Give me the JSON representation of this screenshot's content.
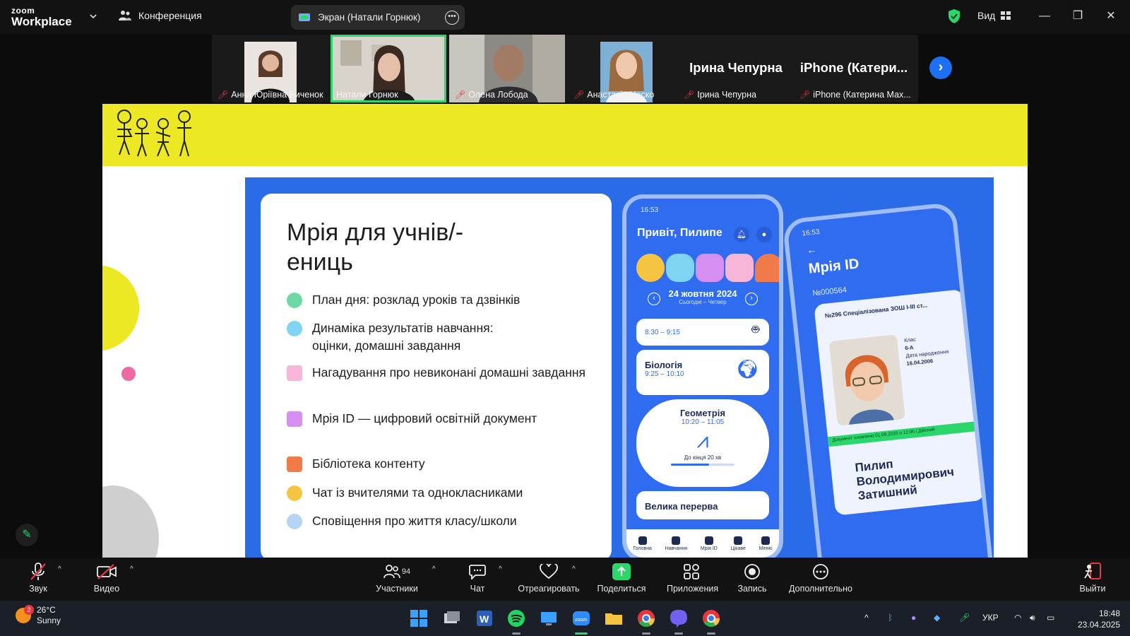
{
  "titlebar": {
    "app_logo_top": "zoom",
    "app_logo_bottom": "Workplace",
    "conference_label": "Конференция",
    "share_pill_label": "Экран (Натали Горнюк)",
    "view_label": "Вид"
  },
  "participants": [
    {
      "name": "Анна Юріївна Биченок",
      "kind": "video",
      "active": false
    },
    {
      "name": "Натали Горнюк",
      "kind": "video",
      "active": true
    },
    {
      "name": "Олена Лобода",
      "kind": "video",
      "active": false
    },
    {
      "name": "Анастасія Носко",
      "kind": "video",
      "active": false
    },
    {
      "name": "Ірина Чепурна",
      "display": "Ірина Чепурна",
      "kind": "name",
      "active": false
    },
    {
      "name": "iPhone (Катерина Мах...",
      "display": "iPhone (Катери...",
      "kind": "name",
      "active": false
    }
  ],
  "slide": {
    "title": "Мрія для учнів/-ениць",
    "features": [
      {
        "text": "План дня: розклад уроків та дзвінків",
        "color": "#6fd9a4",
        "shape": "round"
      },
      {
        "text": "Динаміка результатів навчання: оцінки, домашні завдання",
        "color": "#7fd4f2",
        "shape": "round"
      },
      {
        "text": "Нагадування про невиконані домашні завдання",
        "color": "#f7b6d8",
        "shape": "sq"
      },
      {
        "text": "Мрія ID —  цифровий освітній документ",
        "color": "#d58ff0",
        "shape": "sq"
      },
      {
        "text": "Бібліотека контенту",
        "color": "#f07a4a",
        "shape": "sq"
      },
      {
        "text": "Чат із вчителями та однокласниками",
        "color": "#f5c542",
        "shape": "round"
      },
      {
        "text": "Сповіщення про життя класу/школи",
        "color": "#b8d4f5",
        "shape": "round"
      }
    ],
    "phone1": {
      "time": "16:53",
      "greeting": "Привіт, Пилипе",
      "date": "24 жовтня 2024",
      "date_sub": "Сьогодні – Четвер",
      "lesson_prev_time": "8:30 – 9:15",
      "lesson1_title": "Біологія",
      "lesson1_time": "9:25 – 10:10",
      "lesson2_title": "Геометрія",
      "lesson2_time": "10:20 – 11:05",
      "lesson2_left": "До кінця 20 хв",
      "break_title": "Велика перерва",
      "tabs": [
        "Головна",
        "Навчання",
        "Мрія ID",
        "Цікаве",
        "Меню"
      ]
    },
    "phone2": {
      "time": "16:53",
      "title": "Мрія ID",
      "number": "№000564",
      "school": "№296 Спеціалізована ЗОШ І-ІІІ ст...",
      "class_label": "Клас",
      "class_value": "6-А",
      "birth_label": "Дата народження",
      "birth_value": "16.04.2006",
      "updated": "Документ оновлено 01.09.2025 о 12:06 | Дійсний",
      "person_name": "Пилип Володимирович Затишний"
    }
  },
  "controls": {
    "audio": "Звук",
    "video": "Видео",
    "participants": "Участники",
    "participants_count": "94",
    "chat": "Чат",
    "react": "Отреагировать",
    "share": "Поделиться",
    "apps": "Приложения",
    "record": "Запись",
    "more": "Дополнительно",
    "leave": "Выйти"
  },
  "taskbar": {
    "temp": "26°C",
    "condition": "Sunny",
    "weather_badge": "2",
    "language": "УКР",
    "time": "18:48",
    "date": "23.04.2025"
  },
  "colors": {
    "accent_green": "#2bd66b",
    "slide_yellow": "#ece924",
    "slide_blue": "#2b6be8",
    "mute_red": "#e8363c"
  }
}
